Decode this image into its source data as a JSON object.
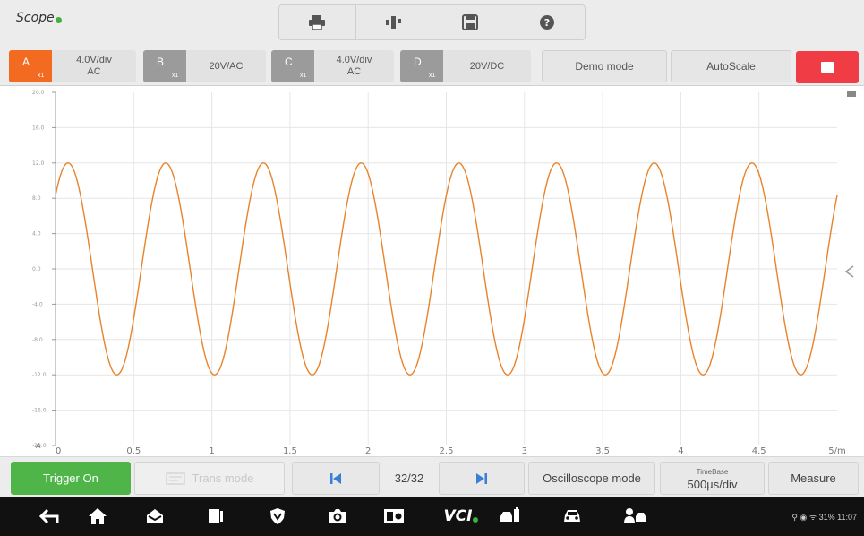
{
  "app": {
    "title": "Scope"
  },
  "toolbar": {
    "tools": [
      "print-icon",
      "signal-icon",
      "save-icon",
      "help-icon"
    ]
  },
  "channels": [
    {
      "letter": "A",
      "mult": "x1",
      "line1": "4.0V/div",
      "line2": "AC",
      "color": "#f26b21"
    },
    {
      "letter": "B",
      "mult": "x1",
      "line1": "20V/AC",
      "line2": "",
      "color": "#9b9b9b"
    },
    {
      "letter": "C",
      "mult": "x1",
      "line1": "4.0V/div",
      "line2": "AC",
      "color": "#9b9b9b"
    },
    {
      "letter": "D",
      "mult": "x1",
      "line1": "20V/DC",
      "line2": "",
      "color": "#9b9b9b"
    }
  ],
  "buttons": {
    "demo_mode": "Demo mode",
    "autoscale": "AutoScale"
  },
  "chart_data": {
    "type": "line",
    "x_ticks": [
      "0",
      "0.5",
      "1",
      "1.5",
      "2",
      "2.5",
      "3",
      "3.5",
      "4",
      "4.5",
      "5/m"
    ],
    "y_ticks": [
      "20.0",
      "16.0",
      "12.0",
      "8.0",
      "4.0",
      "0.0",
      "-4.0",
      "-8.0",
      "-12.0",
      "-16.0",
      "-20.0"
    ],
    "xlim": [
      0,
      5
    ],
    "ylim": [
      -20,
      20
    ],
    "series": [
      {
        "amplitude": 12,
        "period": 0.625,
        "phase_start": 0.08,
        "color": "#e8832a"
      }
    ],
    "grid": true,
    "channel_marker": "A"
  },
  "controls": {
    "trigger_on": "Trigger On",
    "trans_mode": "Trans mode",
    "page": "32/32",
    "oscilloscope_mode": "Oscilloscope mode",
    "timebase_label": "TimeBase",
    "timebase_value": "500µs/div",
    "measure": "Measure"
  },
  "navbar": {
    "items": [
      "back-icon",
      "home-icon",
      "inbox-icon",
      "recent-apps-icon",
      "vci-shield-icon",
      "camera-icon",
      "display-icon",
      "vci-logo-icon",
      "car-service-icon",
      "car-icon",
      "remote-expert-icon"
    ],
    "vci_text": "VCI",
    "status": "31% 11:07"
  }
}
